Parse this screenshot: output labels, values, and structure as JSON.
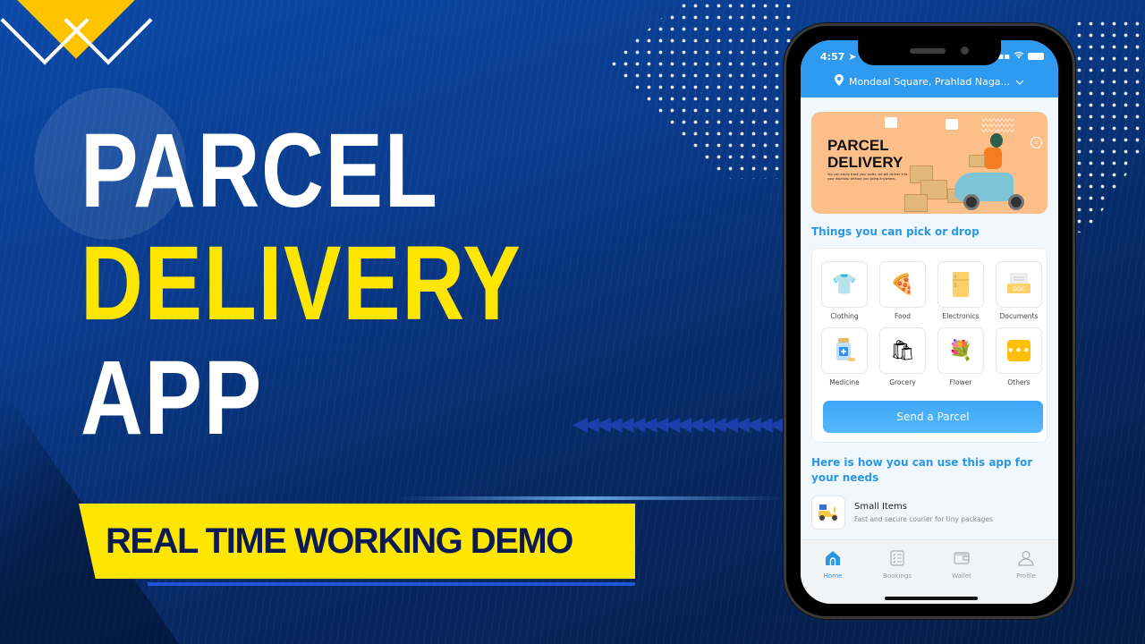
{
  "thumbnail": {
    "title_lines": [
      "PARCEL",
      "DELIVERY",
      "APP"
    ],
    "subtitle_banner": "REAL TIME WORKING DEMO",
    "colors": {
      "background": "#0a3a8a",
      "accent_yellow": "#ffe600",
      "title_white": "#ffffff",
      "banner_text": "#0b1a52"
    }
  },
  "phone": {
    "status_bar": {
      "time": "4:57",
      "location_arrow_icon": "location-arrow-icon",
      "signal_icon": "signal-icon",
      "wifi_icon": "wifi-icon",
      "battery_icon": "battery-icon"
    },
    "header": {
      "location_icon": "map-pin-icon",
      "location_text": "Mondeal Square, Prahlad Naga...",
      "dropdown_icon": "chevron-down-icon",
      "color": "#2e9bf0"
    },
    "promo_banner": {
      "title_line1": "PARCEL",
      "title_line2": "DELIVERY",
      "subtext": "You can easily track your order, we will deliver it to your doorstep without you going anywhere.",
      "nav_icon": "chevron-left-icon",
      "background": "#fcbf8a"
    },
    "categories_section": {
      "title": "Things you can pick or  drop",
      "items": [
        {
          "label": "Clothing",
          "icon": "clothing-icon",
          "glyph": "👕"
        },
        {
          "label": "Food",
          "icon": "pizza-icon",
          "glyph": "🍕"
        },
        {
          "label": "Electronics",
          "icon": "fridge-icon",
          "glyph": "🗄"
        },
        {
          "label": "Documents",
          "icon": "document-icon",
          "glyph": "📄"
        },
        {
          "label": "Medicine",
          "icon": "medicine-icon",
          "glyph": "💊"
        },
        {
          "label": "Grocery",
          "icon": "grocery-bag-icon",
          "glyph": "🛍"
        },
        {
          "label": "Flower",
          "icon": "flower-bouquet-icon",
          "glyph": "💐"
        },
        {
          "label": "Others",
          "icon": "more-icon",
          "glyph": "•••"
        }
      ],
      "send_button": "Send a Parcel"
    },
    "usage_section": {
      "title": "Here is how you can use this app for your needs",
      "items": [
        {
          "title": "Small Items",
          "description": "Fast and secure courier for tiny packages",
          "icon": "scooter-icon"
        }
      ]
    },
    "tab_bar": {
      "active": "Home",
      "tabs": [
        {
          "label": "Home",
          "icon": "home-icon"
        },
        {
          "label": "Bookings",
          "icon": "checklist-icon"
        },
        {
          "label": "Wallet",
          "icon": "wallet-icon"
        },
        {
          "label": "Profile",
          "icon": "user-icon"
        }
      ]
    }
  }
}
